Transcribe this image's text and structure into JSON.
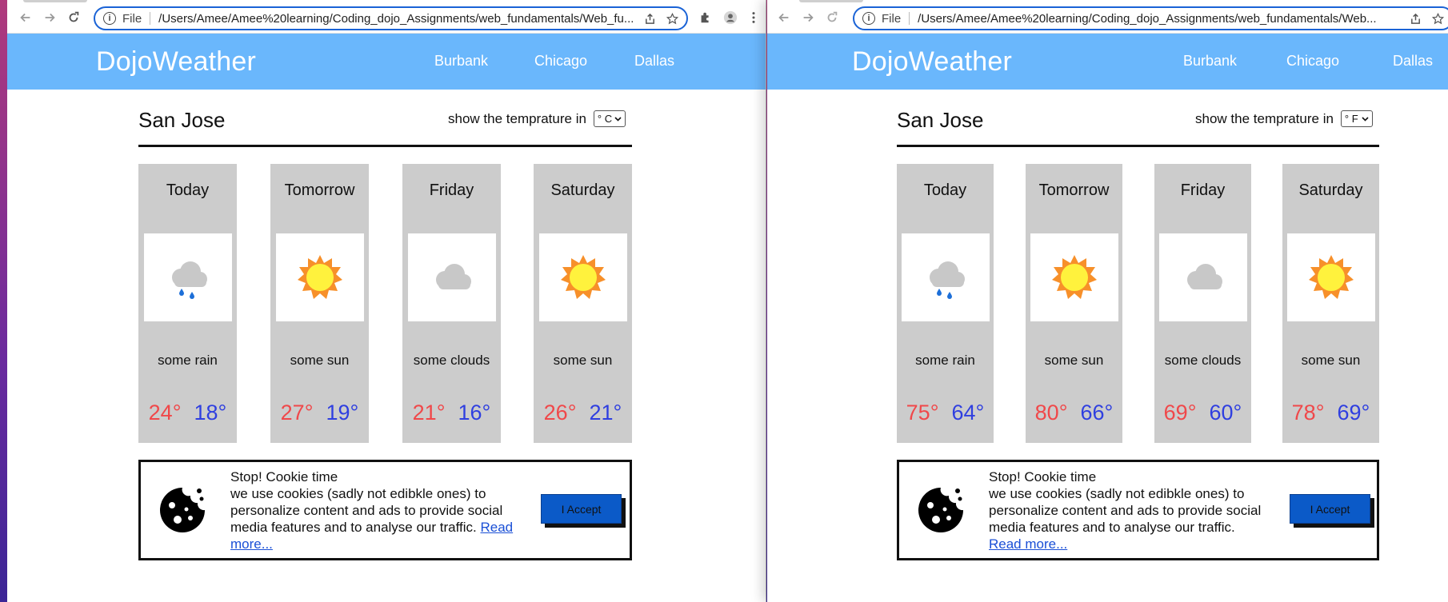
{
  "browser": {
    "scheme": "File",
    "left_url": "/Users/Amee/Amee%20learning/Coding_dojo_Assignments/web_fundamentals/Web_fu...",
    "right_url": "/Users/Amee/Amee%20learning/Coding_dojo_Assignments/web_fundamentals/Web..."
  },
  "site": {
    "brand": "DojoWeather",
    "nav": [
      "Burbank",
      "Chicago",
      "Dallas"
    ],
    "city": "San Jose",
    "unit_prompt": "show the temprature in"
  },
  "left": {
    "unit": "° C",
    "days": [
      {
        "day": "Today",
        "desc": "some rain",
        "hi": "24°",
        "lo": "18°",
        "icon": "rain-cloud-icon"
      },
      {
        "day": "Tomorrow",
        "desc": "some sun",
        "hi": "27°",
        "lo": "19°",
        "icon": "sun-icon"
      },
      {
        "day": "Friday",
        "desc": "some clouds",
        "hi": "21°",
        "lo": "16°",
        "icon": "cloud-icon"
      },
      {
        "day": "Saturday",
        "desc": "some sun",
        "hi": "26°",
        "lo": "21°",
        "icon": "sun-icon"
      }
    ]
  },
  "right": {
    "unit": "° F",
    "days": [
      {
        "day": "Today",
        "desc": "some rain",
        "hi": "75°",
        "lo": "64°",
        "icon": "rain-cloud-icon"
      },
      {
        "day": "Tomorrow",
        "desc": "some sun",
        "hi": "80°",
        "lo": "66°",
        "icon": "sun-icon"
      },
      {
        "day": "Friday",
        "desc": "some clouds",
        "hi": "69°",
        "lo": "60°",
        "icon": "cloud-icon"
      },
      {
        "day": "Saturday",
        "desc": "some sun",
        "hi": "78°",
        "lo": "69°",
        "icon": "sun-icon"
      }
    ]
  },
  "cookie": {
    "title": "Stop! Cookie time",
    "line1": "we use cookies (sadly not edibkle ones) to",
    "line2": "personalize content and ads to provide social",
    "line3": "media features and to analyse our traffic.",
    "read_more": "Read more...",
    "read_more_left_a": "Read",
    "read_more_left_b": "more...",
    "accept": "I Accept"
  },
  "colors": {
    "navbar": "#6ab7fc",
    "card": "#cccccc",
    "hi_temp": "#f0484a",
    "lo_temp": "#2f3fe0",
    "accept_button": "#0b5ac8"
  }
}
